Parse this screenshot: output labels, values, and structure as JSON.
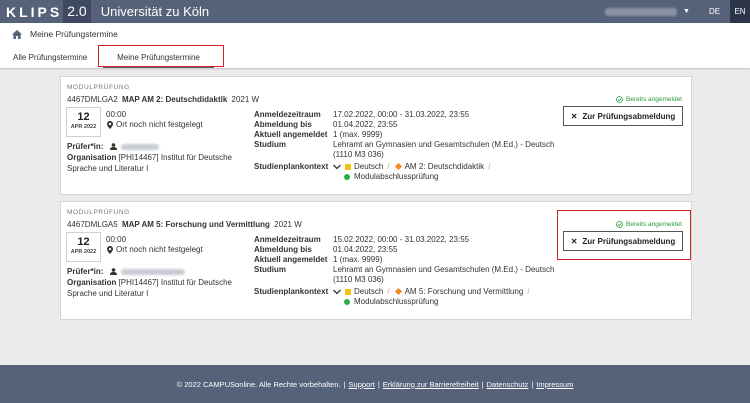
{
  "header": {
    "logo_text": "KLIPS",
    "logo_version": "2.0",
    "university": "Universität zu Köln",
    "lang_de": "DE",
    "lang_en": "EN"
  },
  "breadcrumb": {
    "title": "Meine Prüfungstermine"
  },
  "tabs": [
    {
      "label": "Alle Prüfungstermine"
    },
    {
      "label": "Meine Prüfungstermine",
      "active": true
    }
  ],
  "labels": {
    "type": "MODULPRÜFUNG",
    "pruefer": "Prüfer*in:",
    "organisation": "Organisation",
    "anmeldezeitraum": "Anmeldezeitraum",
    "abmeldung_bis": "Abmeldung bis",
    "aktuell_angemeldet": "Aktuell angemeldet",
    "studium": "Studium",
    "studienplankontext": "Studienplankontext",
    "status": "Bereits angemeldet",
    "button": "Zur Prüfungsabmeldung"
  },
  "exams": [
    {
      "code": "4467DMLGA2",
      "name": "MAP AM 2: Deutschdidaktik",
      "semester": "2021 W",
      "day": "12",
      "month": "APR 2022",
      "time": "00:00",
      "ort": "Ort noch nicht festgelegt",
      "org_code": "[PHI14467]",
      "org_name": "Institut für Deutsche Sprache und Literatur I",
      "anmeldezeitraum": "17.02.2022, 00:00 - 31.03.2022, 23:55",
      "abmeldung_bis": "01.04.2022, 23:55",
      "aktuell_angemeldet": "1 (max. 9999)",
      "studium": "Lehramt an Gymnasien und Gesamtschulen (M.Ed.) - Deutsch (1110 M3 036)",
      "ctx_1": "Deutsch",
      "ctx_2": "AM 2: Deutschdidaktik",
      "ctx_3": "Modulabschlussprüfung"
    },
    {
      "code": "4467DMLGA5",
      "name": "MAP AM 5: Forschung und Vermittlung",
      "semester": "2021 W",
      "day": "12",
      "month": "APR 2022",
      "time": "00:00",
      "ort": "Ort noch nicht festgelegt",
      "org_code": "[PHI14467]",
      "org_name": "Institut für Deutsche Sprache und Literatur I",
      "anmeldezeitraum": "15.02.2022, 00:00 - 31.03.2022, 23:55",
      "abmeldung_bis": "01.04.2022, 23:55",
      "aktuell_angemeldet": "1 (max. 9999)",
      "studium": "Lehramt an Gymnasien und Gesamtschulen (M.Ed.) - Deutsch (1110 M3 036)",
      "ctx_1": "Deutsch",
      "ctx_2": "AM 5: Forschung und Vermittlung",
      "ctx_3": "Modulabschlussprüfung"
    }
  ],
  "footer": {
    "copyright": "© 2022 CAMPUSonline. Alle Rechte vorbehalten.",
    "links": [
      "Support",
      "Erklärung zur Barrierefreiheit",
      "Datenschutz",
      "Impressum"
    ]
  },
  "colors": {
    "header_bg": "#56617a",
    "highlight_red": "#d42027",
    "status_green": "#2a9a3c"
  },
  "icons": [
    "home-icon",
    "map-pin-icon",
    "person-icon",
    "chevron-down-icon",
    "check-circle-icon",
    "close-icon",
    "caret-down-icon"
  ]
}
